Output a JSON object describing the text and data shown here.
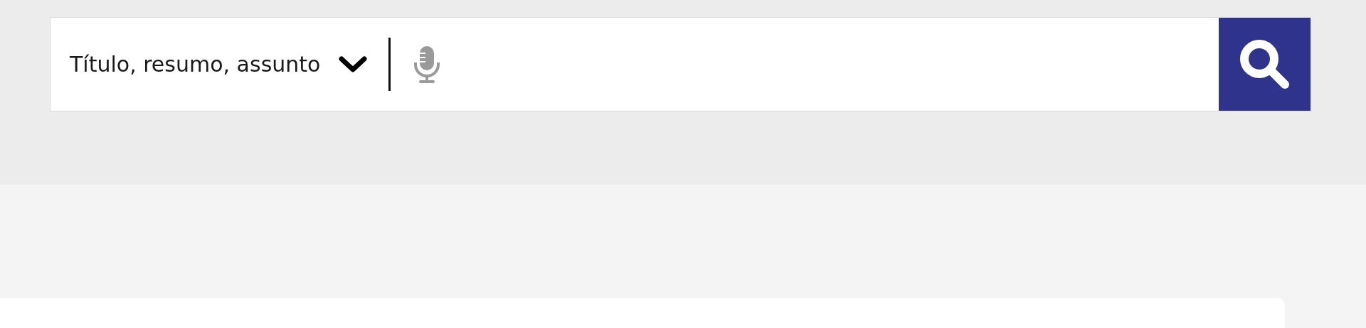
{
  "search": {
    "scope": "Título, resumo, assunto"
  }
}
